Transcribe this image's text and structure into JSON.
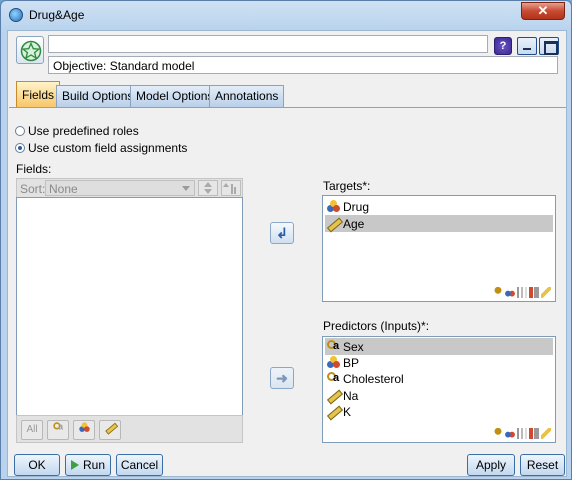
{
  "window": {
    "title": "Drug&Age"
  },
  "header": {
    "node_name": "",
    "objective": "Objective: Standard model",
    "help_label": "?"
  },
  "tabs": [
    {
      "label": "Fields",
      "active": true
    },
    {
      "label": "Build Options",
      "active": false
    },
    {
      "label": "Model Options",
      "active": false
    },
    {
      "label": "Annotations",
      "active": false
    }
  ],
  "roles": {
    "option_predefined": "Use predefined roles",
    "option_custom": "Use custom field assignments",
    "selected": "custom"
  },
  "fields_panel": {
    "label": "Fields:",
    "sort_label": "Sort:",
    "sort_value": "None",
    "footer_buttons": [
      "All",
      "flag",
      "nominal",
      "continuous"
    ],
    "items": []
  },
  "targets": {
    "label": "Targets*:",
    "items": [
      {
        "name": "Drug",
        "icon": "nominal-icon",
        "selected": false
      },
      {
        "name": "Age",
        "icon": "continuous-icon",
        "selected": true
      }
    ]
  },
  "predictors": {
    "label": "Predictors (Inputs)*:",
    "items": [
      {
        "name": "Sex",
        "icon": "flag-icon",
        "selected": true
      },
      {
        "name": "BP",
        "icon": "nominal-icon",
        "selected": false
      },
      {
        "name": "Cholesterol",
        "icon": "flag-icon",
        "selected": false
      },
      {
        "name": "Na",
        "icon": "continuous-icon",
        "selected": false
      },
      {
        "name": "K",
        "icon": "continuous-icon",
        "selected": false
      }
    ]
  },
  "buttons": {
    "ok": "OK",
    "run": "Run",
    "cancel": "Cancel",
    "apply": "Apply",
    "reset": "Reset"
  },
  "colors": {
    "title_bg": "#b9d3ee",
    "active_tab": "#f7c66a",
    "selection": "#c8c8c8",
    "close_button": "#c74a33"
  }
}
